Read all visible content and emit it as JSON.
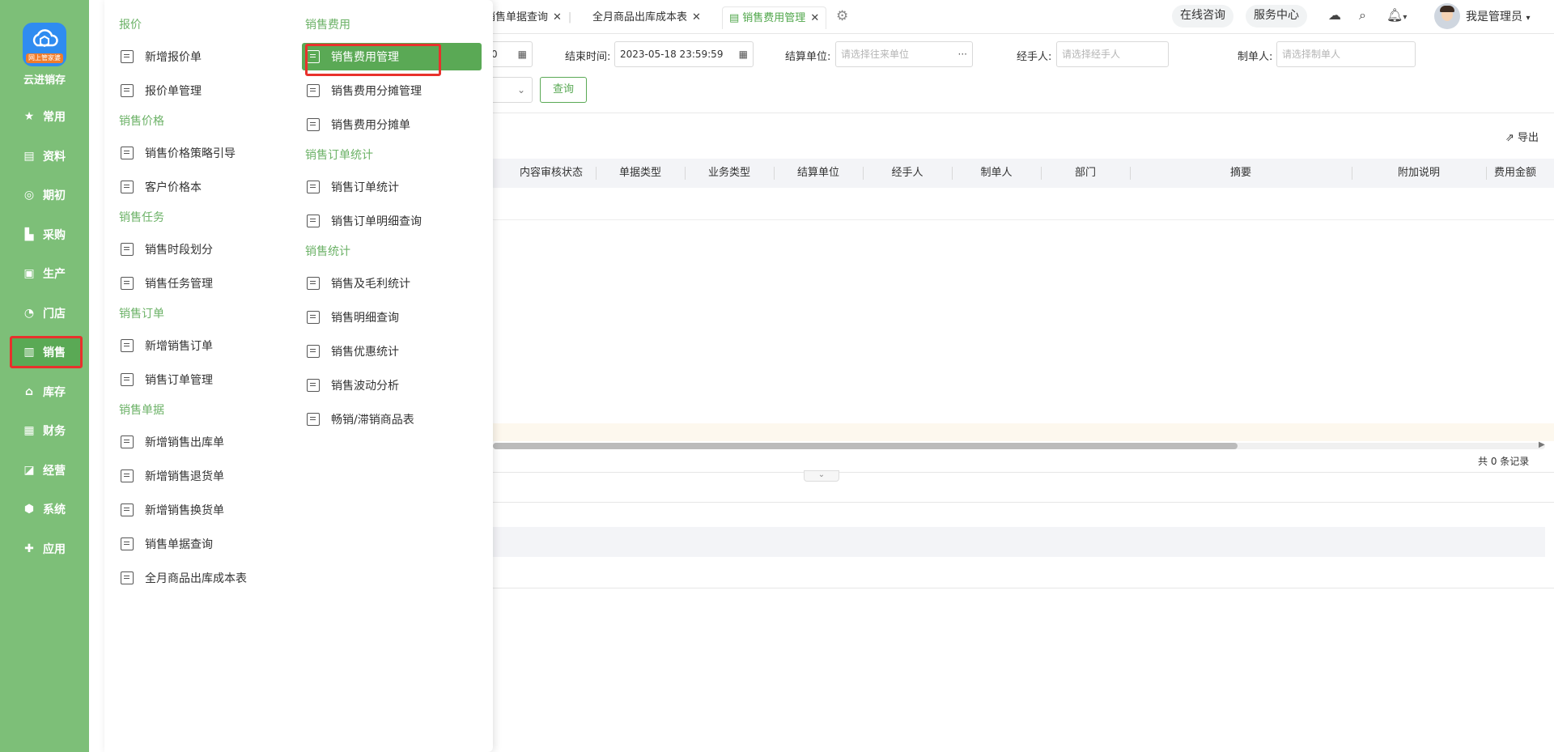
{
  "brand": {
    "name": "云进销存",
    "badge": "网上管家婆"
  },
  "sidebar": {
    "items": [
      {
        "label": "常用",
        "icon": "star-icon",
        "glyph": "★"
      },
      {
        "label": "资料",
        "icon": "document-icon",
        "glyph": "▤"
      },
      {
        "label": "期初",
        "icon": "target-icon",
        "glyph": "◎"
      },
      {
        "label": "采购",
        "icon": "cart-icon",
        "glyph": "▙"
      },
      {
        "label": "生产",
        "icon": "factory-icon",
        "glyph": "▣"
      },
      {
        "label": "门店",
        "icon": "pie-icon",
        "glyph": "◔"
      },
      {
        "label": "销售",
        "icon": "chart-icon",
        "glyph": "▥",
        "active": true
      },
      {
        "label": "库存",
        "icon": "warehouse-icon",
        "glyph": "⌂"
      },
      {
        "label": "财务",
        "icon": "wallet-icon",
        "glyph": "▦"
      },
      {
        "label": "经营",
        "icon": "trend-icon",
        "glyph": "◪"
      },
      {
        "label": "系统",
        "icon": "settings-icon",
        "glyph": "⬢"
      },
      {
        "label": "应用",
        "icon": "plus-icon",
        "glyph": "✚"
      }
    ]
  },
  "menu": {
    "col1": [
      {
        "title": "报价",
        "items": [
          "新增报价单",
          "报价单管理"
        ]
      },
      {
        "title": "销售价格",
        "items": [
          "销售价格策略引导",
          "客户价格本"
        ]
      },
      {
        "title": "销售任务",
        "items": [
          "销售时段划分",
          "销售任务管理"
        ]
      },
      {
        "title": "销售订单",
        "items": [
          "新增销售订单",
          "销售订单管理"
        ]
      },
      {
        "title": "销售单据",
        "items": [
          "新增销售出库单",
          "新增销售退货单",
          "新增销售换货单",
          "销售单据查询",
          "全月商品出库成本表"
        ]
      }
    ],
    "col2": [
      {
        "title": "销售费用",
        "items": [
          "销售费用管理",
          "销售费用分摊管理",
          "销售费用分摊单"
        ]
      },
      {
        "title": "销售订单统计",
        "items": [
          "销售订单统计",
          "销售订单明细查询"
        ]
      },
      {
        "title": "销售统计",
        "items": [
          "销售及毛利统计",
          "销售明细查询",
          "销售优惠统计",
          "销售波动分析",
          "畅销/滞销商品表"
        ]
      }
    ],
    "selected": "销售费用管理"
  },
  "tabs": [
    {
      "label": "销售单据查询",
      "active": false
    },
    {
      "label": "全月商品出库成本表",
      "active": false
    },
    {
      "label": "销售费用管理",
      "active": true
    }
  ],
  "topbar": {
    "consult": "在线咨询",
    "service": "服务中心",
    "user": "我是管理员"
  },
  "filters": {
    "start_tail": "0",
    "end_label": "结束时间:",
    "end_value": "2023-05-18 23:59:59",
    "unit_label": "结算单位:",
    "unit_placeholder": "请选择往来单位",
    "handler_label": "经手人:",
    "handler_placeholder": "请选择经手人",
    "maker_label": "制单人:",
    "maker_placeholder": "请选择制单人",
    "query_button": "查询"
  },
  "toolbar": {
    "export": "导出"
  },
  "table": {
    "columns": [
      "内容审核状态",
      "单据类型",
      "业务类型",
      "结算单位",
      "经手人",
      "制单人",
      "部门",
      "摘要",
      "附加说明",
      "费用金额"
    ]
  },
  "footer": {
    "record_count": "共 0 条记录",
    "bottom_tab_fragment": "费"
  },
  "colors": {
    "sidebar": "#7dbf78",
    "accent": "#5aa955",
    "highlight": "#e8312c"
  }
}
